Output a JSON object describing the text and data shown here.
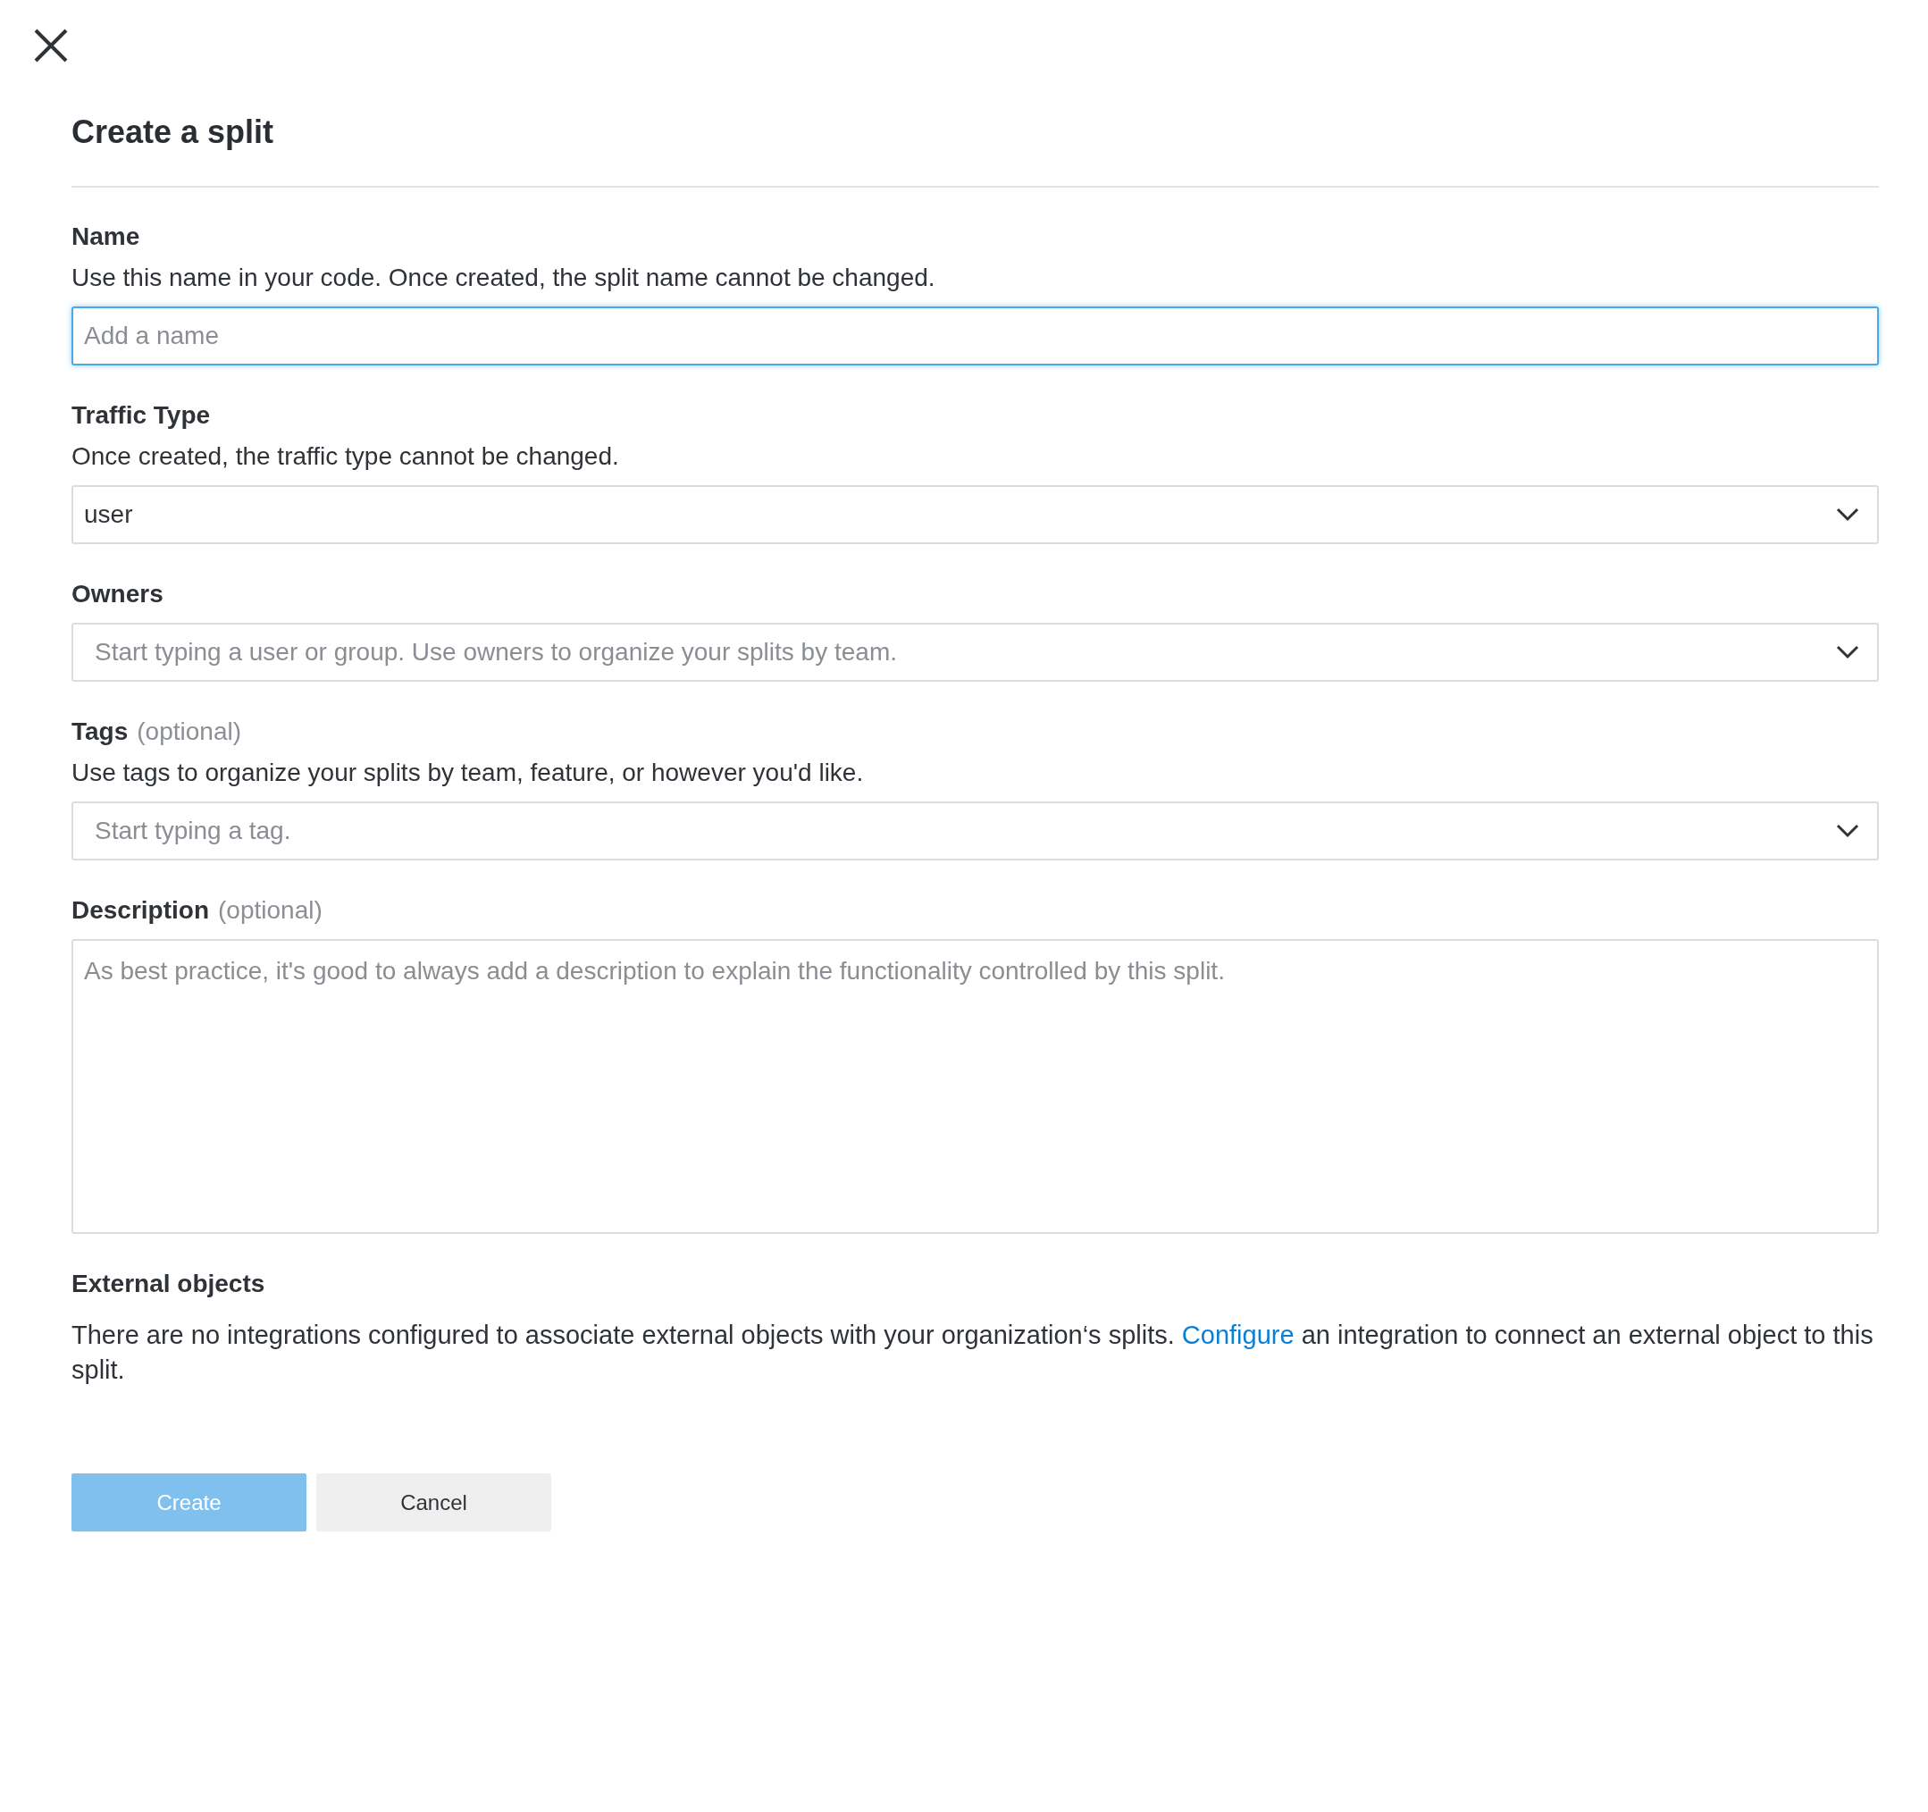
{
  "title": "Create a split",
  "fields": [
    {
      "kind": "text",
      "label": "Name",
      "helper": "Use this name in your code. Once created, the split name cannot be changed.",
      "placeholder": "Add a name",
      "focused": true
    },
    {
      "kind": "select",
      "label": "Traffic Type",
      "helper": "Once created, the traffic type cannot be changed.",
      "value": "user",
      "focused": false
    },
    {
      "kind": "select",
      "label": "Owners",
      "placeholder": "Start typing a user or group. Use owners to organize your splits by team.",
      "focused": false
    },
    {
      "kind": "select",
      "label": "Tags",
      "optional": "(optional)",
      "helper": "Use tags to organize your splits by team, feature, or however you'd like.",
      "placeholder": "Start typing a tag.",
      "focused": false
    },
    {
      "kind": "textarea",
      "label": "Description",
      "optional": "(optional)",
      "placeholder": "As best practice, it's good to always add a description to explain the functionality controlled by this split.",
      "focused": false
    }
  ],
  "external_objects": {
    "title": "External objects",
    "text_before": "There are no integrations configured to associate external objects with your organization‘s splits.",
    "link": "Configure",
    "text_after": "an integration to connect an external object to this split."
  },
  "buttons": [
    {
      "label": "Create",
      "kind": "primary",
      "disabled": true
    },
    {
      "label": "Cancel",
      "kind": "secondary",
      "disabled": false
    }
  ]
}
